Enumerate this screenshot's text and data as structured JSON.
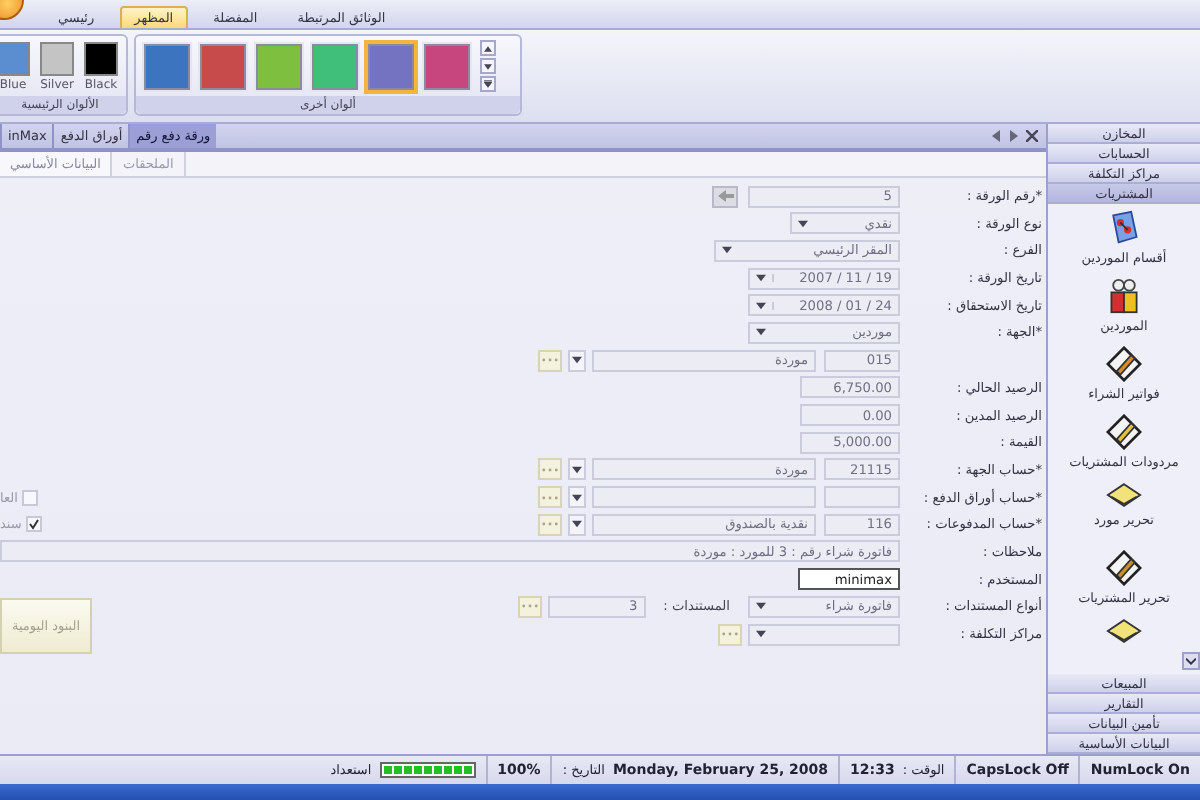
{
  "ribbon": {
    "tabs": [
      {
        "label": "الوثائق المرتبطة",
        "selected": false
      },
      {
        "label": "المفضلة",
        "selected": false
      },
      {
        "label": "المظهر",
        "selected": true
      },
      {
        "label": "رئيسي",
        "selected": false
      }
    ],
    "other_colors": {
      "caption": "ألوان أخرى",
      "swatches": [
        {
          "color": "#c8467e",
          "selected": false
        },
        {
          "color": "#7373c2",
          "selected": true
        },
        {
          "color": "#3fbf7a",
          "selected": false
        },
        {
          "color": "#7fbf3f",
          "selected": false
        },
        {
          "color": "#c84b4b",
          "selected": false
        },
        {
          "color": "#3d74c0",
          "selected": false
        }
      ]
    },
    "main_colors": {
      "caption": "الألوان الرئيسية",
      "swatches": [
        {
          "label": "Black",
          "color": "#000000"
        },
        {
          "label": "Silver",
          "color": "#c4c4c4"
        },
        {
          "label": "Blue",
          "color": "#5a8ed0"
        }
      ]
    }
  },
  "document_tabs": [
    {
      "label": "ورقة دفع رقم",
      "selected": true
    },
    {
      "label": "أوراق الدفع",
      "selected": false
    },
    {
      "label": "inMax",
      "selected": false
    }
  ],
  "form": {
    "tabs": [
      {
        "label": "الملحقات",
        "selected": false
      },
      {
        "label": "البيانات الأساسي",
        "selected": true
      }
    ],
    "rows": [
      {
        "kind": "lookup",
        "label": "*رقم الورقة :",
        "value": "5"
      },
      {
        "kind": "select",
        "label": "نوع الورقة :",
        "value": "نقدي"
      },
      {
        "kind": "select",
        "label": "الفرع :",
        "value": "المقر الرئيسي"
      },
      {
        "kind": "date",
        "label": "تاريخ الورقة :",
        "value": "2007 / 11 / 19"
      },
      {
        "kind": "date",
        "label": "تاريخ الاستحقاق :",
        "value": "2008 / 01 / 24"
      },
      {
        "kind": "select",
        "label": "*الجهة :",
        "value": "موردين"
      },
      {
        "kind": "account",
        "code": "015",
        "name": "موردة"
      },
      {
        "kind": "amount",
        "label": "الرصيد الحالي :",
        "value": "6,750.00"
      },
      {
        "kind": "amount",
        "label": "الرصيد المدين :",
        "value": "0.00"
      },
      {
        "kind": "amount",
        "label": "القيمة :",
        "value": "5,000.00"
      },
      {
        "kind": "account",
        "label": "*حساب الجهة :",
        "code": "21115",
        "name": "موردة"
      },
      {
        "kind": "account",
        "label": "*حساب أوراق الدفع :",
        "option": {
          "label": "العا",
          "checked": false
        }
      },
      {
        "kind": "account",
        "label": "*حساب المدفوعات :",
        "code": "116",
        "name": "نقدية بالصندوق",
        "option": {
          "label": "سند",
          "checked": true
        }
      },
      {
        "kind": "note",
        "label": "ملاحظات :",
        "value": "فاتورة شراء رقم : 3 للمورد : موردة"
      },
      {
        "kind": "user",
        "label": "المستخدم :",
        "value": "minimax"
      },
      {
        "kind": "doc-types",
        "label": "أنواع المستندات :",
        "value": "فاتورة شراء",
        "count_label": "المستندات :",
        "count": "3",
        "button": "البنود اليومية"
      },
      {
        "kind": "cost",
        "label": "مراكز التكلفة :"
      }
    ]
  },
  "sidebar": {
    "sections": [
      {
        "label": "المخازن",
        "selected": false
      },
      {
        "label": "الحسابات",
        "selected": false
      },
      {
        "label": "مراكز التكلفة",
        "selected": false
      },
      {
        "label": "المشتريات",
        "selected": true,
        "items": [
          {
            "label": "أقسام الموردين"
          },
          {
            "label": "الموردين"
          },
          {
            "label": "فواتير الشراء"
          },
          {
            "label": "مردودات المشتريات"
          },
          {
            "label": "تحرير مورد"
          },
          {
            "label": "تحرير المشتريات"
          }
        ]
      },
      {
        "label": "المبيعات",
        "selected": false
      },
      {
        "label": "التقارير",
        "selected": false
      },
      {
        "label": "تأمين البيانات",
        "selected": false
      },
      {
        "label": "البيانات الأساسية",
        "selected": false
      }
    ]
  },
  "status_bar": {
    "num_lock": "NumLock On",
    "caps_lock": "CapsLock Off",
    "time_label": "الوقت :",
    "time": "12:33",
    "date_label": "التاريخ :",
    "date": "Monday, February 25, 2008",
    "zoom": "100%",
    "progress": {
      "level": 1
    },
    "state": "استعداد"
  }
}
